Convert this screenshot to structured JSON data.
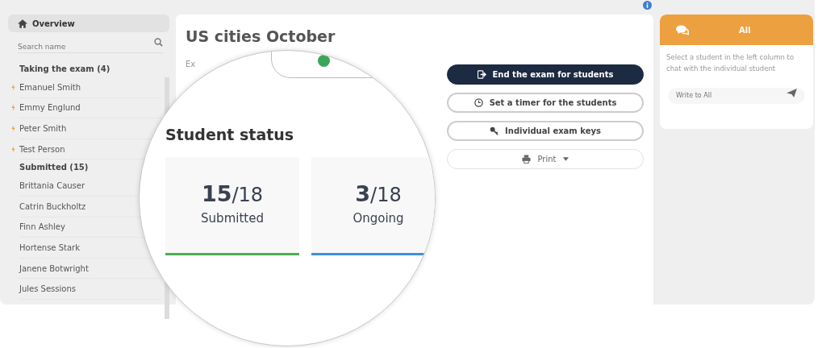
{
  "sidebar": {
    "overview": "Overview",
    "search": {
      "placeholder": "Search name"
    },
    "groups": [
      {
        "title": "Taking the exam (4)",
        "kind": "active",
        "students": [
          "Emanuel Smith",
          "Emmy Englund",
          "Peter Smith",
          "Test Person"
        ]
      },
      {
        "title": "Submitted (15)",
        "kind": "done",
        "students": [
          "Brittania Causer",
          "Catrin Buckholtz",
          "Finn Ashley",
          "Hortense Stark",
          "Janene Botwright",
          "Jules Sessions"
        ]
      }
    ]
  },
  "main": {
    "title": "US cities October",
    "label": "Ex",
    "status_pill": {
      "color": "#3aa657"
    },
    "buttons": [
      {
        "label": "End the exam for students",
        "kind": "primary"
      },
      {
        "label": "Set a timer for the students",
        "kind": "outline"
      },
      {
        "label": "Individual exam keys",
        "kind": "outline"
      },
      {
        "label": "Print",
        "kind": "light"
      }
    ]
  },
  "magnifier": {
    "heading": "Student status",
    "stats": [
      {
        "count": "15",
        "total": "/18",
        "label": "Submitted",
        "color": "#4caf50"
      },
      {
        "count": "3",
        "total": "/18",
        "label": "Ongoing",
        "color": "#3d8fe0"
      }
    ]
  },
  "chat": {
    "tab": "All",
    "hint": "Select a student in the left column to chat with the individual student",
    "input": {
      "placeholder": "Write to All"
    }
  }
}
